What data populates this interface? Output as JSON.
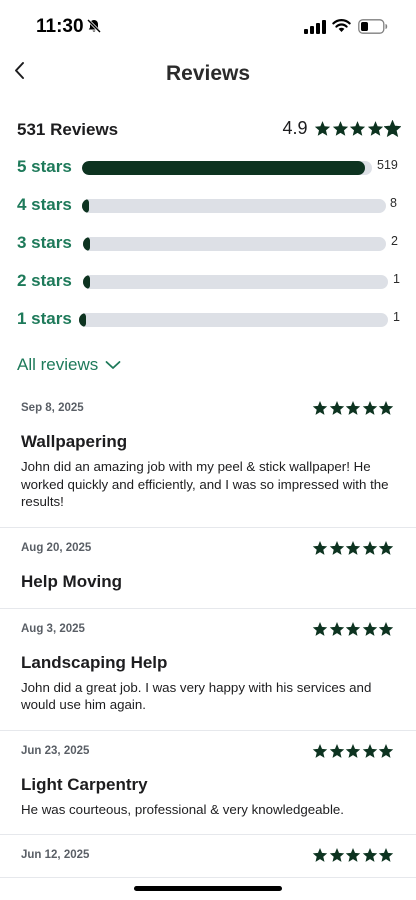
{
  "status_bar": {
    "time": "11:30"
  },
  "nav": {
    "title": "Reviews"
  },
  "summary": {
    "count_label": "531 Reviews",
    "average": "4.9",
    "average_value": 4.9
  },
  "breakdown": [
    {
      "label": "5 stars",
      "count": "519",
      "fraction": 0.977
    },
    {
      "label": "4 stars",
      "count": "8",
      "fraction": 0.015
    },
    {
      "label": "3 stars",
      "count": "2",
      "fraction": 0.004
    },
    {
      "label": "2 stars",
      "count": "1",
      "fraction": 0.002
    },
    {
      "label": "1 stars",
      "count": "1",
      "fraction": 0.002
    }
  ],
  "all_reviews": {
    "label": "All reviews"
  },
  "reviews": [
    {
      "date": "Sep 8, 2025",
      "rating": 5,
      "title": "Wallpapering",
      "body": "John did an amazing job with my peel & stick wallpaper! He worked quickly and efficiently, and I was so impressed with the results!"
    },
    {
      "date": "Aug 20, 2025",
      "rating": 5,
      "title": "Help Moving",
      "body": ""
    },
    {
      "date": "Aug 3, 2025",
      "rating": 5,
      "title": "Landscaping Help",
      "body": "John did a great job. I was very happy with his services and would use him again."
    },
    {
      "date": "Jun 23, 2025",
      "rating": 5,
      "title": "Light Carpentry",
      "body": "He was courteous, professional & very knowledgeable."
    },
    {
      "date": "Jun 12, 2025",
      "rating": 5,
      "title": "",
      "body": ""
    }
  ],
  "colors": {
    "accent_green": "#1e7a5a",
    "star_dark_green": "#0d3320",
    "bar_track": "#dde0e6"
  }
}
